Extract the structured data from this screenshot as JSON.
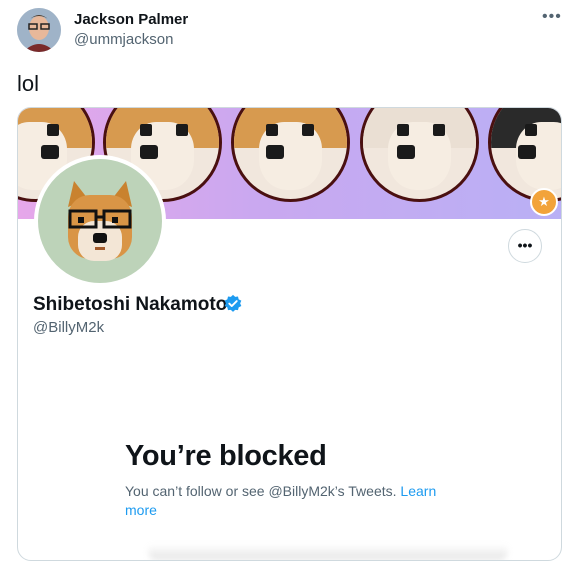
{
  "tweet": {
    "author_name": "Jackson Palmer",
    "author_handle": "@ummjackson",
    "more_label": "•••",
    "text": "lol"
  },
  "profile_card": {
    "display_name": "Shibetoshi Nakamoto",
    "handle": "@BillyM2k",
    "verified": true,
    "more_label": "•••",
    "blocked_title": "You’re blocked",
    "blocked_message": "You can’t follow or see @BillyM2k’s Tweets.",
    "learn_more_label": "Learn more"
  },
  "colors": {
    "link": "#1d9bf0",
    "secondary_text": "#536471",
    "banner_start": "#e6a7ea",
    "banner_end": "#b9b0f5",
    "avatar_bg": "#bdd3b9"
  },
  "icons": {
    "verified": "verified-badge-icon",
    "banner_badge": "award-badge-icon"
  }
}
